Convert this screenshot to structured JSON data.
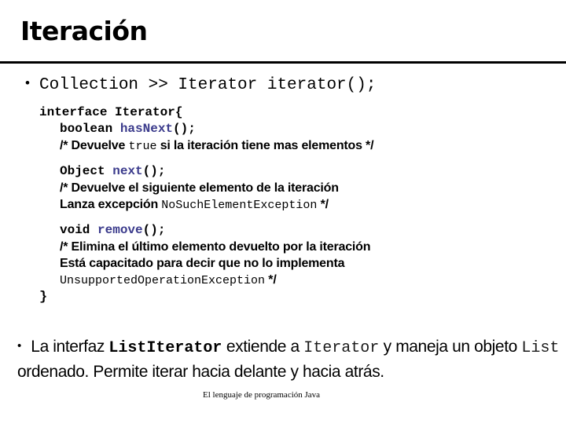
{
  "slide": {
    "title": "Iteración",
    "footer": "El lenguaje de programación Java"
  },
  "top_bullet": {
    "bullet": "•",
    "text": "Collection >> Iterator iterator();"
  },
  "code": {
    "open_line": "interface Iterator{",
    "close_line": "}",
    "groups": [
      {
        "signature": {
          "keyword": "boolean",
          "method": "hasNext",
          "punct": "();"
        },
        "comments": [
          {
            "parts": [
              {
                "kind": "sans",
                "text": "/* Devuelve "
              },
              {
                "kind": "mono",
                "text": "true"
              },
              {
                "kind": "sans",
                "text": " si la iteración tiene mas elementos */"
              }
            ]
          }
        ]
      },
      {
        "signature": {
          "keyword": "Object",
          "method": "next",
          "punct": "();"
        },
        "comments": [
          {
            "parts": [
              {
                "kind": "sans",
                "text": "/* Devuelve el siguiente elemento de la iteración"
              }
            ]
          },
          {
            "parts": [
              {
                "kind": "sans",
                "text": "Lanza excepción "
              },
              {
                "kind": "mono",
                "text": "NoSuchElementException"
              },
              {
                "kind": "sans",
                "text": " */"
              }
            ]
          }
        ]
      },
      {
        "signature": {
          "keyword": "void",
          "method": "remove",
          "punct": "();"
        },
        "comments": [
          {
            "parts": [
              {
                "kind": "sans",
                "text": "/* Elimina el último elemento devuelto por la iteración"
              }
            ]
          },
          {
            "parts": [
              {
                "kind": "sans",
                "text": "Está capacitado para decir que no lo implementa"
              }
            ]
          },
          {
            "parts": [
              {
                "kind": "mono",
                "text": "UnsupportedOperationException"
              },
              {
                "kind": "sans",
                "text": " */"
              }
            ]
          }
        ]
      }
    ]
  },
  "bottom_bullet": {
    "bullet": "•",
    "parts": [
      {
        "kind": "sans",
        "text": " La interfaz "
      },
      {
        "kind": "mono-bold",
        "text": "ListIterator"
      },
      {
        "kind": "sans",
        "text": " extiende a "
      },
      {
        "kind": "mono",
        "text": "Iterator"
      },
      {
        "kind": "sans",
        "text": " y maneja un objeto "
      },
      {
        "kind": "mono",
        "text": "List"
      },
      {
        "kind": "sans",
        "text": " ordenado. Permite iterar hacia delante y hacia atrás."
      }
    ]
  },
  "colors": {
    "text": "#000000",
    "method_blue": "#3b3b8c",
    "rule": "#000000",
    "background": "#ffffff"
  }
}
